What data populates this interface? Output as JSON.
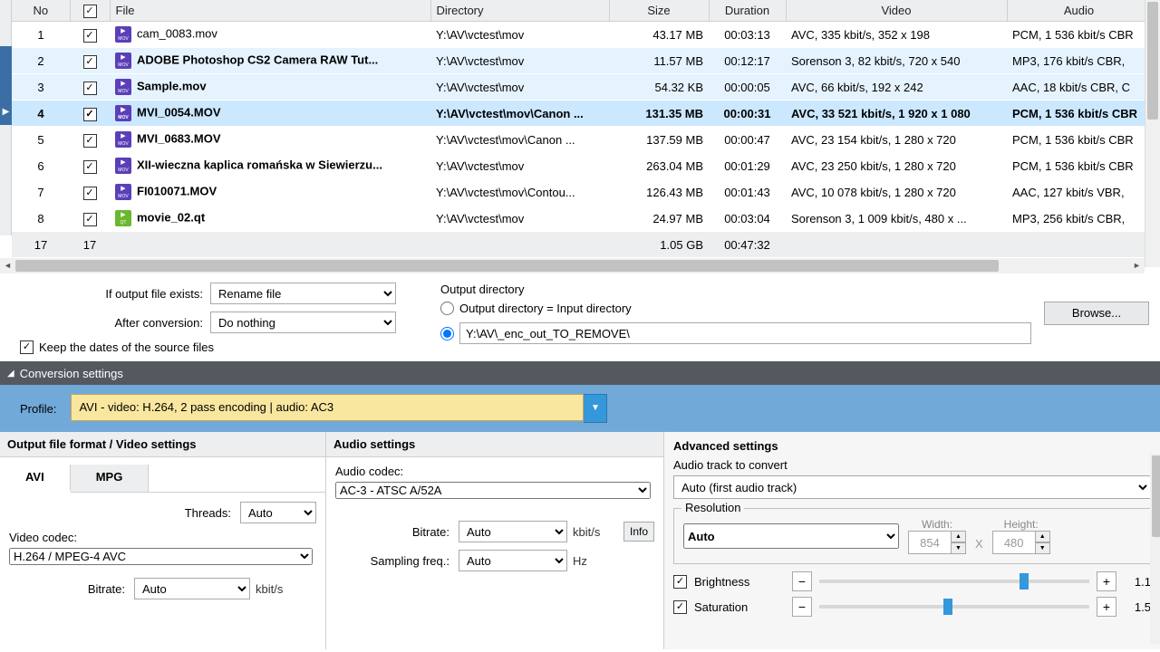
{
  "table": {
    "headers": {
      "no": "No",
      "chk": "",
      "file": "File",
      "dir": "Directory",
      "size": "Size",
      "dur": "Duration",
      "vid": "Video",
      "aud": "Audio"
    },
    "rows": [
      {
        "no": "1",
        "file": "cam_0083.mov",
        "dir": "Y:\\AV\\vctest\\mov",
        "size": "43.17 MB",
        "dur": "00:03:13",
        "vid": "AVC, 335 kbit/s, 352 x 198",
        "aud": "PCM, 1 536 kbit/s CBR",
        "bold": false,
        "sel": false,
        "semi": false,
        "icon": "mov"
      },
      {
        "no": "2",
        "file": "ADOBE Photoshop CS2 Camera RAW Tut...",
        "dir": "Y:\\AV\\vctest\\mov",
        "size": "11.57 MB",
        "dur": "00:12:17",
        "vid": "Sorenson 3, 82 kbit/s, 720 x 540",
        "aud": "MP3, 176 kbit/s CBR,",
        "bold": true,
        "sel": false,
        "semi": true,
        "icon": "mov"
      },
      {
        "no": "3",
        "file": "Sample.mov",
        "dir": "Y:\\AV\\vctest\\mov",
        "size": "54.32 KB",
        "dur": "00:00:05",
        "vid": "AVC, 66 kbit/s, 192 x 242",
        "aud": "AAC, 18 kbit/s CBR, C",
        "bold": true,
        "sel": false,
        "semi": true,
        "icon": "mov"
      },
      {
        "no": "4",
        "file": "MVI_0054.MOV",
        "dir": "Y:\\AV\\vctest\\mov\\Canon ...",
        "size": "131.35 MB",
        "dur": "00:00:31",
        "vid": "AVC, 33 521 kbit/s, 1 920 x 1 080",
        "aud": "PCM, 1 536 kbit/s CBR",
        "bold": true,
        "sel": true,
        "semi": false,
        "icon": "mov"
      },
      {
        "no": "5",
        "file": "MVI_0683.MOV",
        "dir": "Y:\\AV\\vctest\\mov\\Canon ...",
        "size": "137.59 MB",
        "dur": "00:00:47",
        "vid": "AVC, 23 154 kbit/s, 1 280 x 720",
        "aud": "PCM, 1 536 kbit/s CBR",
        "bold": true,
        "sel": false,
        "semi": false,
        "icon": "mov"
      },
      {
        "no": "6",
        "file": "XII-wieczna kaplica romańska w Siewierzu...",
        "dir": "Y:\\AV\\vctest\\mov",
        "size": "263.04 MB",
        "dur": "00:01:29",
        "vid": "AVC, 23 250 kbit/s, 1 280 x 720",
        "aud": "PCM, 1 536 kbit/s CBR",
        "bold": true,
        "sel": false,
        "semi": false,
        "icon": "mov"
      },
      {
        "no": "7",
        "file": "FI010071.MOV",
        "dir": "Y:\\AV\\vctest\\mov\\Contou...",
        "size": "126.43 MB",
        "dur": "00:01:43",
        "vid": "AVC, 10 078 kbit/s, 1 280 x 720",
        "aud": "AAC, 127 kbit/s VBR,",
        "bold": true,
        "sel": false,
        "semi": false,
        "icon": "mov"
      },
      {
        "no": "8",
        "file": "movie_02.qt",
        "dir": "Y:\\AV\\vctest\\mov",
        "size": "24.97 MB",
        "dur": "00:03:04",
        "vid": "Sorenson 3, 1 009 kbit/s, 480 x ...",
        "aud": "MP3, 256 kbit/s CBR,",
        "bold": true,
        "sel": false,
        "semi": false,
        "icon": "qt"
      }
    ],
    "summary": {
      "count1": "17",
      "count2": "17",
      "size": "1.05 GB",
      "dur": "00:47:32"
    }
  },
  "mid": {
    "ifexists_label": "If output file exists:",
    "ifexists_value": "Rename file",
    "afterconv_label": "After conversion:",
    "afterconv_value": "Do nothing",
    "keepdates": "Keep the dates of the source files",
    "outdir_label": "Output directory",
    "radio_same": "Output directory = Input directory",
    "outpath": "Y:\\AV\\_enc_out_TO_REMOVE\\",
    "browse": "Browse..."
  },
  "conv_header": "Conversion settings",
  "profile_label": "Profile:",
  "profile_value": "AVI - video: H.264, 2 pass encoding | audio: AC3",
  "colA": {
    "header": "Output file format / Video settings",
    "tab_avi": "AVI",
    "tab_mpg": "MPG",
    "threads_label": "Threads:",
    "threads_value": "Auto",
    "vcodec_label": "Video codec:",
    "vcodec_value": "H.264 / MPEG-4 AVC",
    "bitrate_label": "Bitrate:",
    "bitrate_value": "Auto",
    "bitrate_unit": "kbit/s"
  },
  "colB": {
    "header": "Audio settings",
    "acodec_label": "Audio codec:",
    "acodec_value": "AC-3 - ATSC A/52A",
    "bitrate_label": "Bitrate:",
    "bitrate_value": "Auto",
    "bitrate_unit": "kbit/s",
    "samp_label": "Sampling freq.:",
    "samp_value": "Auto",
    "samp_unit": "Hz",
    "info": "Info"
  },
  "colC": {
    "header": "Advanced settings",
    "track_label": "Audio track to convert",
    "track_value": "Auto (first audio track)",
    "res_title": "Resolution",
    "res_mode": "Auto",
    "width_label": "Width:",
    "height_label": "Height:",
    "width": "854",
    "height": "480",
    "x": "X",
    "brightness": "Brightness",
    "brightness_val": "1.1",
    "saturation": "Saturation",
    "saturation_val": "1.5"
  }
}
